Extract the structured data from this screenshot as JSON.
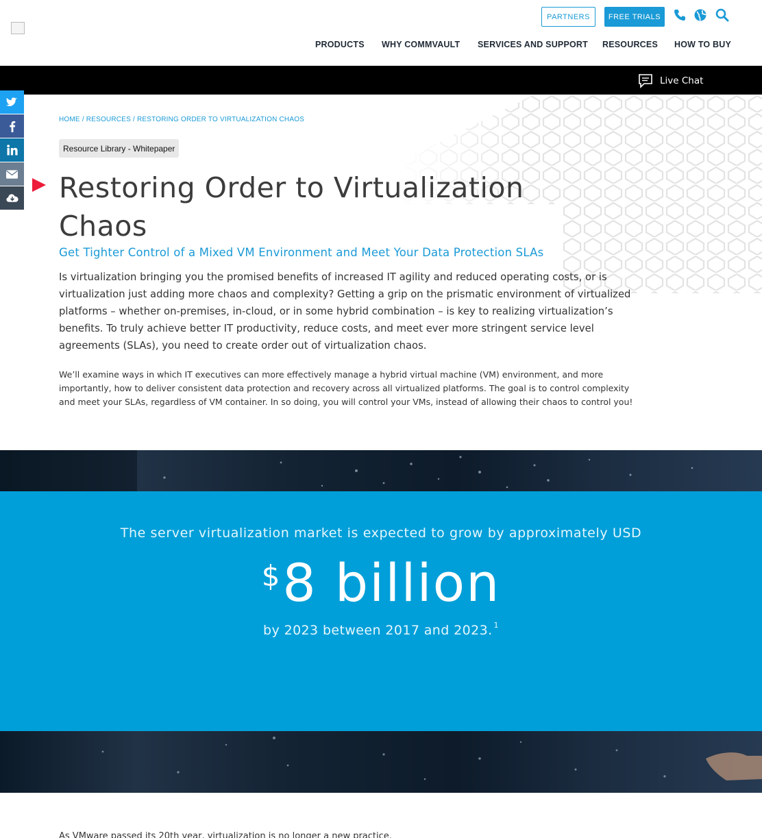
{
  "header": {
    "partners_label": "PARTNERS",
    "free_trials_label": "FREE TRIALS",
    "nav": [
      {
        "label": "PRODUCTS"
      },
      {
        "label": "WHY COMMVAULT"
      },
      {
        "label": "SERVICES AND SUPPORT"
      },
      {
        "label": "RESOURCES"
      },
      {
        "label": "HOW TO BUY"
      }
    ],
    "icons": [
      "phone-icon",
      "globe-icon",
      "search-icon"
    ]
  },
  "chat": {
    "label": "Live Chat",
    "icon": "chat-bubble-icon"
  },
  "social": [
    "twitter-icon",
    "facebook-icon",
    "linkedin-icon",
    "email-icon",
    "cloud-download-icon"
  ],
  "breadcrumb": {
    "home": "HOME",
    "resources": "RESOURCES",
    "current": "RESTORING ORDER TO VIRTUALIZATION CHAOS",
    "sep": "/"
  },
  "article": {
    "tag": "Resource Library - Whitepaper",
    "title": "Restoring Order to Virtualization Chaos",
    "subtitle": "Get Tighter Control of a Mixed VM Environment and Meet Your Data Protection SLAs",
    "lead": "Is virtualization bringing you the promised benefits of increased IT agility and reduced operating costs, or is virtualization just adding more chaos and complexity? Getting a grip on the prismatic environment of virtualized platforms – whether on-premises, in-cloud, or in some hybrid combination – is key to realizing virtualization’s benefits. To truly achieve better IT productivity, reduce costs, and meet ever more stringent service level agreements (SLAs), you need to create order out of virtualization chaos.",
    "body": "We’ll examine ways in which IT executives can more effectively manage a hybrid virtual machine (VM) environment, and more importantly, how to deliver consistent data protection and recovery across all virtualized platforms. The goal is to control complexity and meet your SLAs, regardless of VM container. In so doing, you will control your VMs, instead of allowing their chaos to control you!"
  },
  "stat": {
    "intro": "The server virtualization market is expected to grow by approximately USD",
    "currency": "$",
    "value": "8 billion",
    "outro": "by 2023 between 2017 and 2023.",
    "footnote": "1"
  },
  "next_text": "As VMware passed its 20th year, virtualization is no longer a new practice."
}
